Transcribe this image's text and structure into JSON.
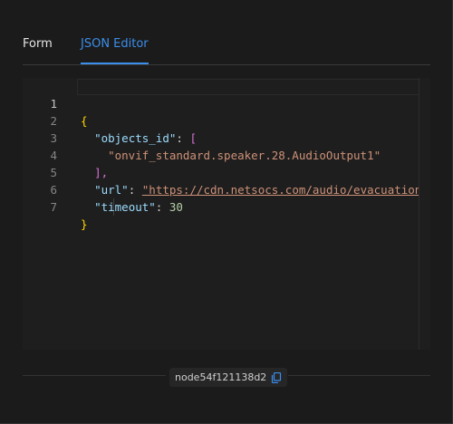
{
  "tabs": [
    {
      "label": "Form"
    },
    {
      "label": "JSON Editor",
      "active": true
    }
  ],
  "editor": {
    "line_numbers": [
      "1",
      "2",
      "3",
      "4",
      "5",
      "6",
      "7"
    ],
    "active_line": "1",
    "tokens": {
      "open_brace": "{",
      "key_objects_id": "\"objects_id\"",
      "open_bracket": "[",
      "value_speaker": "\"onvif_standard.speaker.28.AudioOutput1\"",
      "close_bracket": "],",
      "key_url": "\"url\"",
      "value_url": "\"https://cdn.netsocs.com/audio/evacuation",
      "key_timeout": "\"timeout\"",
      "value_timeout": "30",
      "close_brace": "}"
    }
  },
  "footer": {
    "node_id": "node54f121138d2",
    "copy_icon": "copy-icon"
  },
  "colors": {
    "accent": "#3b8eea",
    "key": "#9cdcfe",
    "string": "#ce9178",
    "number": "#b5cea8",
    "brace": "#ffd700",
    "bracket": "#da70d6"
  }
}
